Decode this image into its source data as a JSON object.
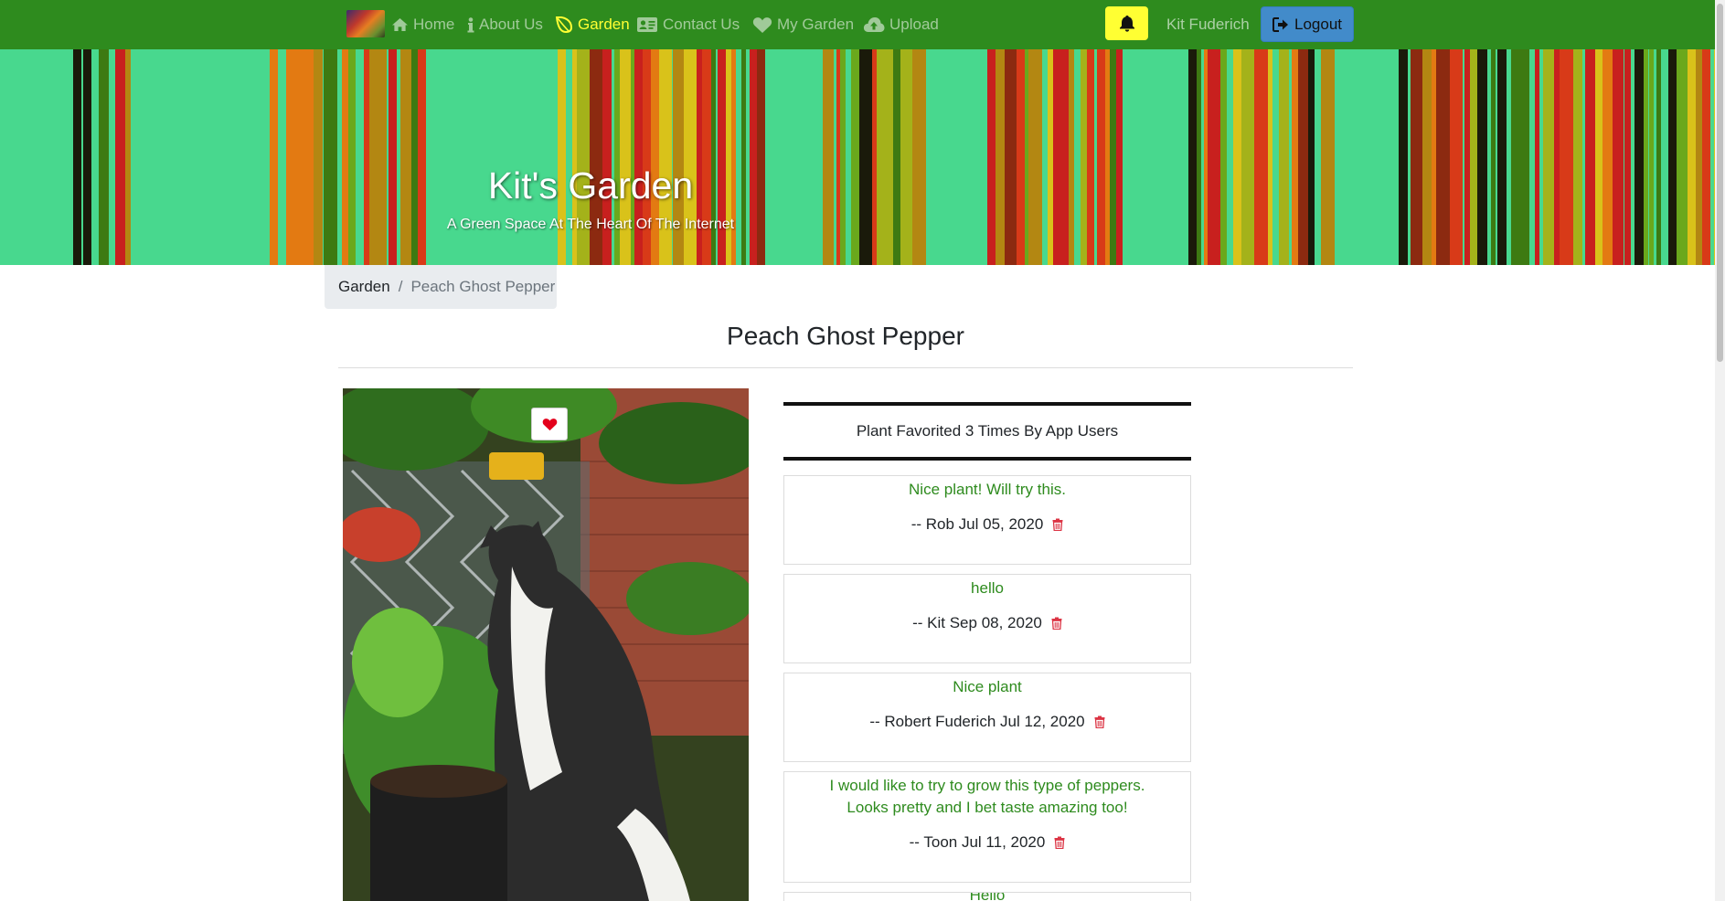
{
  "nav": {
    "items": [
      {
        "label": "Home",
        "icon": "home-icon"
      },
      {
        "label": "About Us",
        "icon": "info-icon"
      },
      {
        "label": "Garden",
        "icon": "leaf-icon",
        "active": true
      },
      {
        "label": "Contact Us",
        "icon": "contact-card-icon"
      },
      {
        "label": "My Garden",
        "icon": "heart-icon"
      },
      {
        "label": "Upload",
        "icon": "cloud-upload-icon"
      }
    ],
    "notifications_icon": "bell-icon",
    "username": "Kit Fuderich",
    "logout_label": "Logout"
  },
  "hero": {
    "title": "Kit's Garden",
    "subtitle": "A Green Space At The Heart Of The Internet"
  },
  "breadcrumb": {
    "home": "Garden",
    "separator": "/",
    "current": "Peach Ghost Pepper"
  },
  "plant": {
    "name": "Peach Ghost Pepper",
    "favorite_icon": "heart-icon",
    "favorited_text": "Plant Favorited 3 Times By App Users"
  },
  "comments": [
    {
      "text": "Nice plant! Will try this.",
      "meta": "-- Rob Jul 05, 2020"
    },
    {
      "text": "hello",
      "meta": "-- Kit Sep 08, 2020"
    },
    {
      "text": "Nice plant",
      "meta": "-- Robert Fuderich Jul 12, 2020"
    },
    {
      "text": "I would like to try to grow this type of peppers. Looks pretty and I bet taste amazing too!",
      "meta": "-- Toon Jul 11, 2020"
    },
    {
      "text": "Hello",
      "meta": ""
    }
  ],
  "colors": {
    "navbar": "#2e8b1e",
    "active_nav": "#ffff33",
    "hero_bg": "#48d88e",
    "comment_text": "#2e8b1e",
    "logout_bg": "#428bca",
    "trash": "#dc3545",
    "heart": "#e3001b"
  }
}
